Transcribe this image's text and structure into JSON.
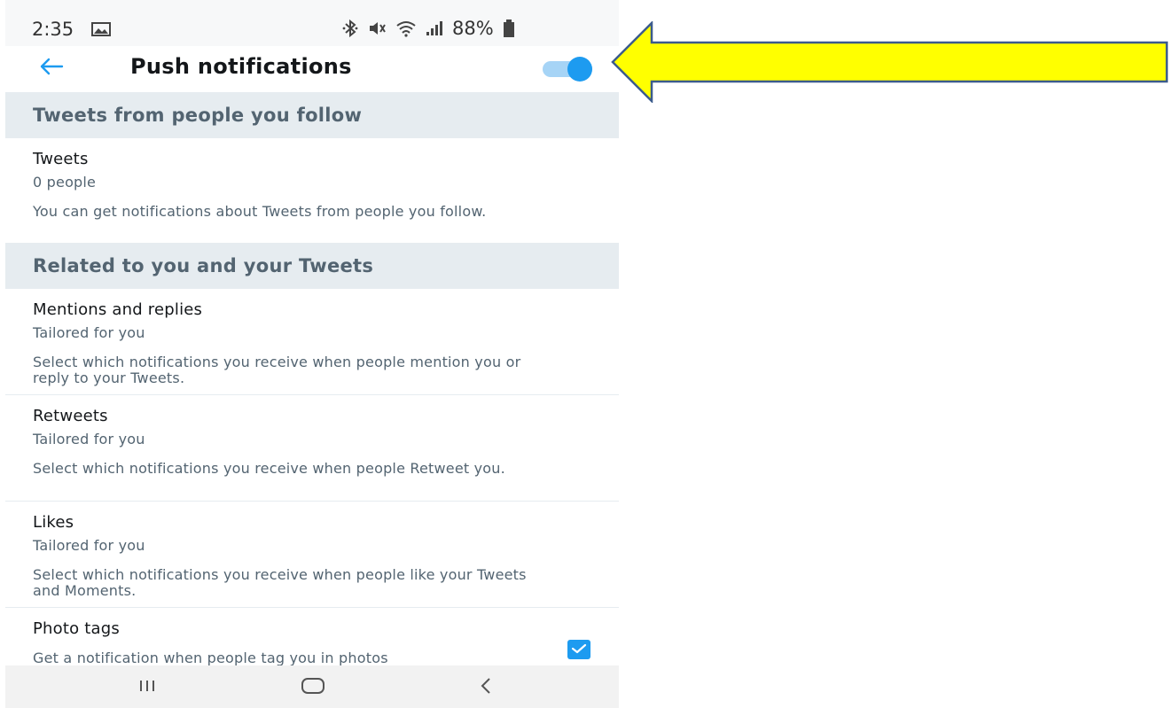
{
  "status_bar": {
    "time": "2:35",
    "battery": "88%",
    "icons": [
      "gallery-icon",
      "bluetooth-icon",
      "mute-icon",
      "wifi-icon",
      "signal-icon",
      "battery-icon"
    ]
  },
  "header": {
    "title": "Push notifications",
    "back_icon": "arrow-left-icon",
    "toggle_on": true
  },
  "sections": [
    {
      "title": "Tweets from people you follow"
    },
    {
      "title": "Related to you and your Tweets"
    }
  ],
  "items": [
    {
      "title": "Tweets",
      "value": "0 people",
      "description": "You can get notifications about Tweets from people you follow."
    },
    {
      "title": "Mentions and replies",
      "value": "Tailored for you",
      "description": "Select which notifications you receive when people mention you or reply to your Tweets."
    },
    {
      "title": "Retweets",
      "value": "Tailored for you",
      "description": "Select which notifications you receive when people Retweet you."
    },
    {
      "title": "Likes",
      "value": "Tailored for you",
      "description": "Select which notifications you receive when people like your Tweets and Moments."
    },
    {
      "title": "Photo tags",
      "description": "Get a notification when people tag you in photos",
      "checked": true
    }
  ],
  "nav_bar": {
    "icons": [
      "recents-icon",
      "home-icon",
      "back-icon"
    ]
  },
  "colors": {
    "accent": "#1d9bf0",
    "section_bg": "#e6ecf0",
    "callout_fill": "#ffff00",
    "callout_stroke": "#3b5b8c"
  }
}
